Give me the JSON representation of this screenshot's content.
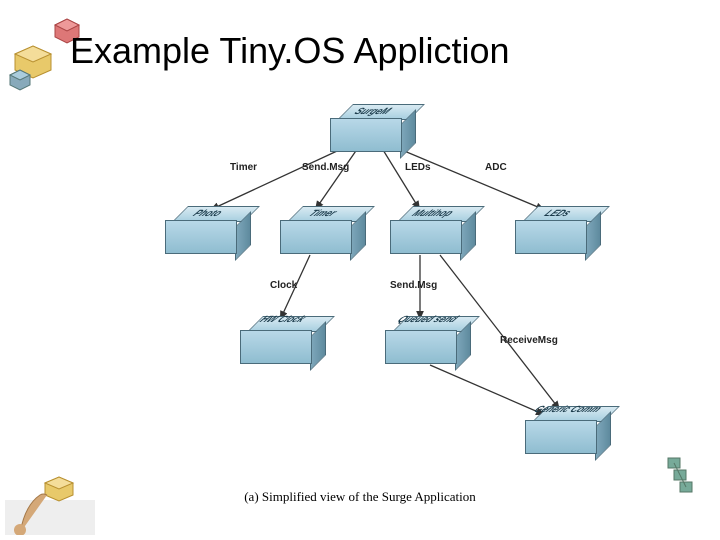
{
  "title": "Example Tiny.OS Appliction",
  "nodes": {
    "surgem": "SurgeM",
    "photo": "Photo",
    "timer": "Timer",
    "multihop": "Multihop",
    "leds": "LEDs",
    "hwclock": "HW\nClock",
    "queued": "Queued\nsend",
    "generic": "Generic\nComm"
  },
  "edges": {
    "e_timer": "Timer",
    "e_sendmsg1": "Send.Msg",
    "e_leds": "LEDs",
    "e_adc": "ADC",
    "e_clock": "Clock",
    "e_sendmsg2": "Send.Msg",
    "e_recvmsg": "ReceiveMsg"
  },
  "caption": "(a) Simplified view of the Surge Application"
}
